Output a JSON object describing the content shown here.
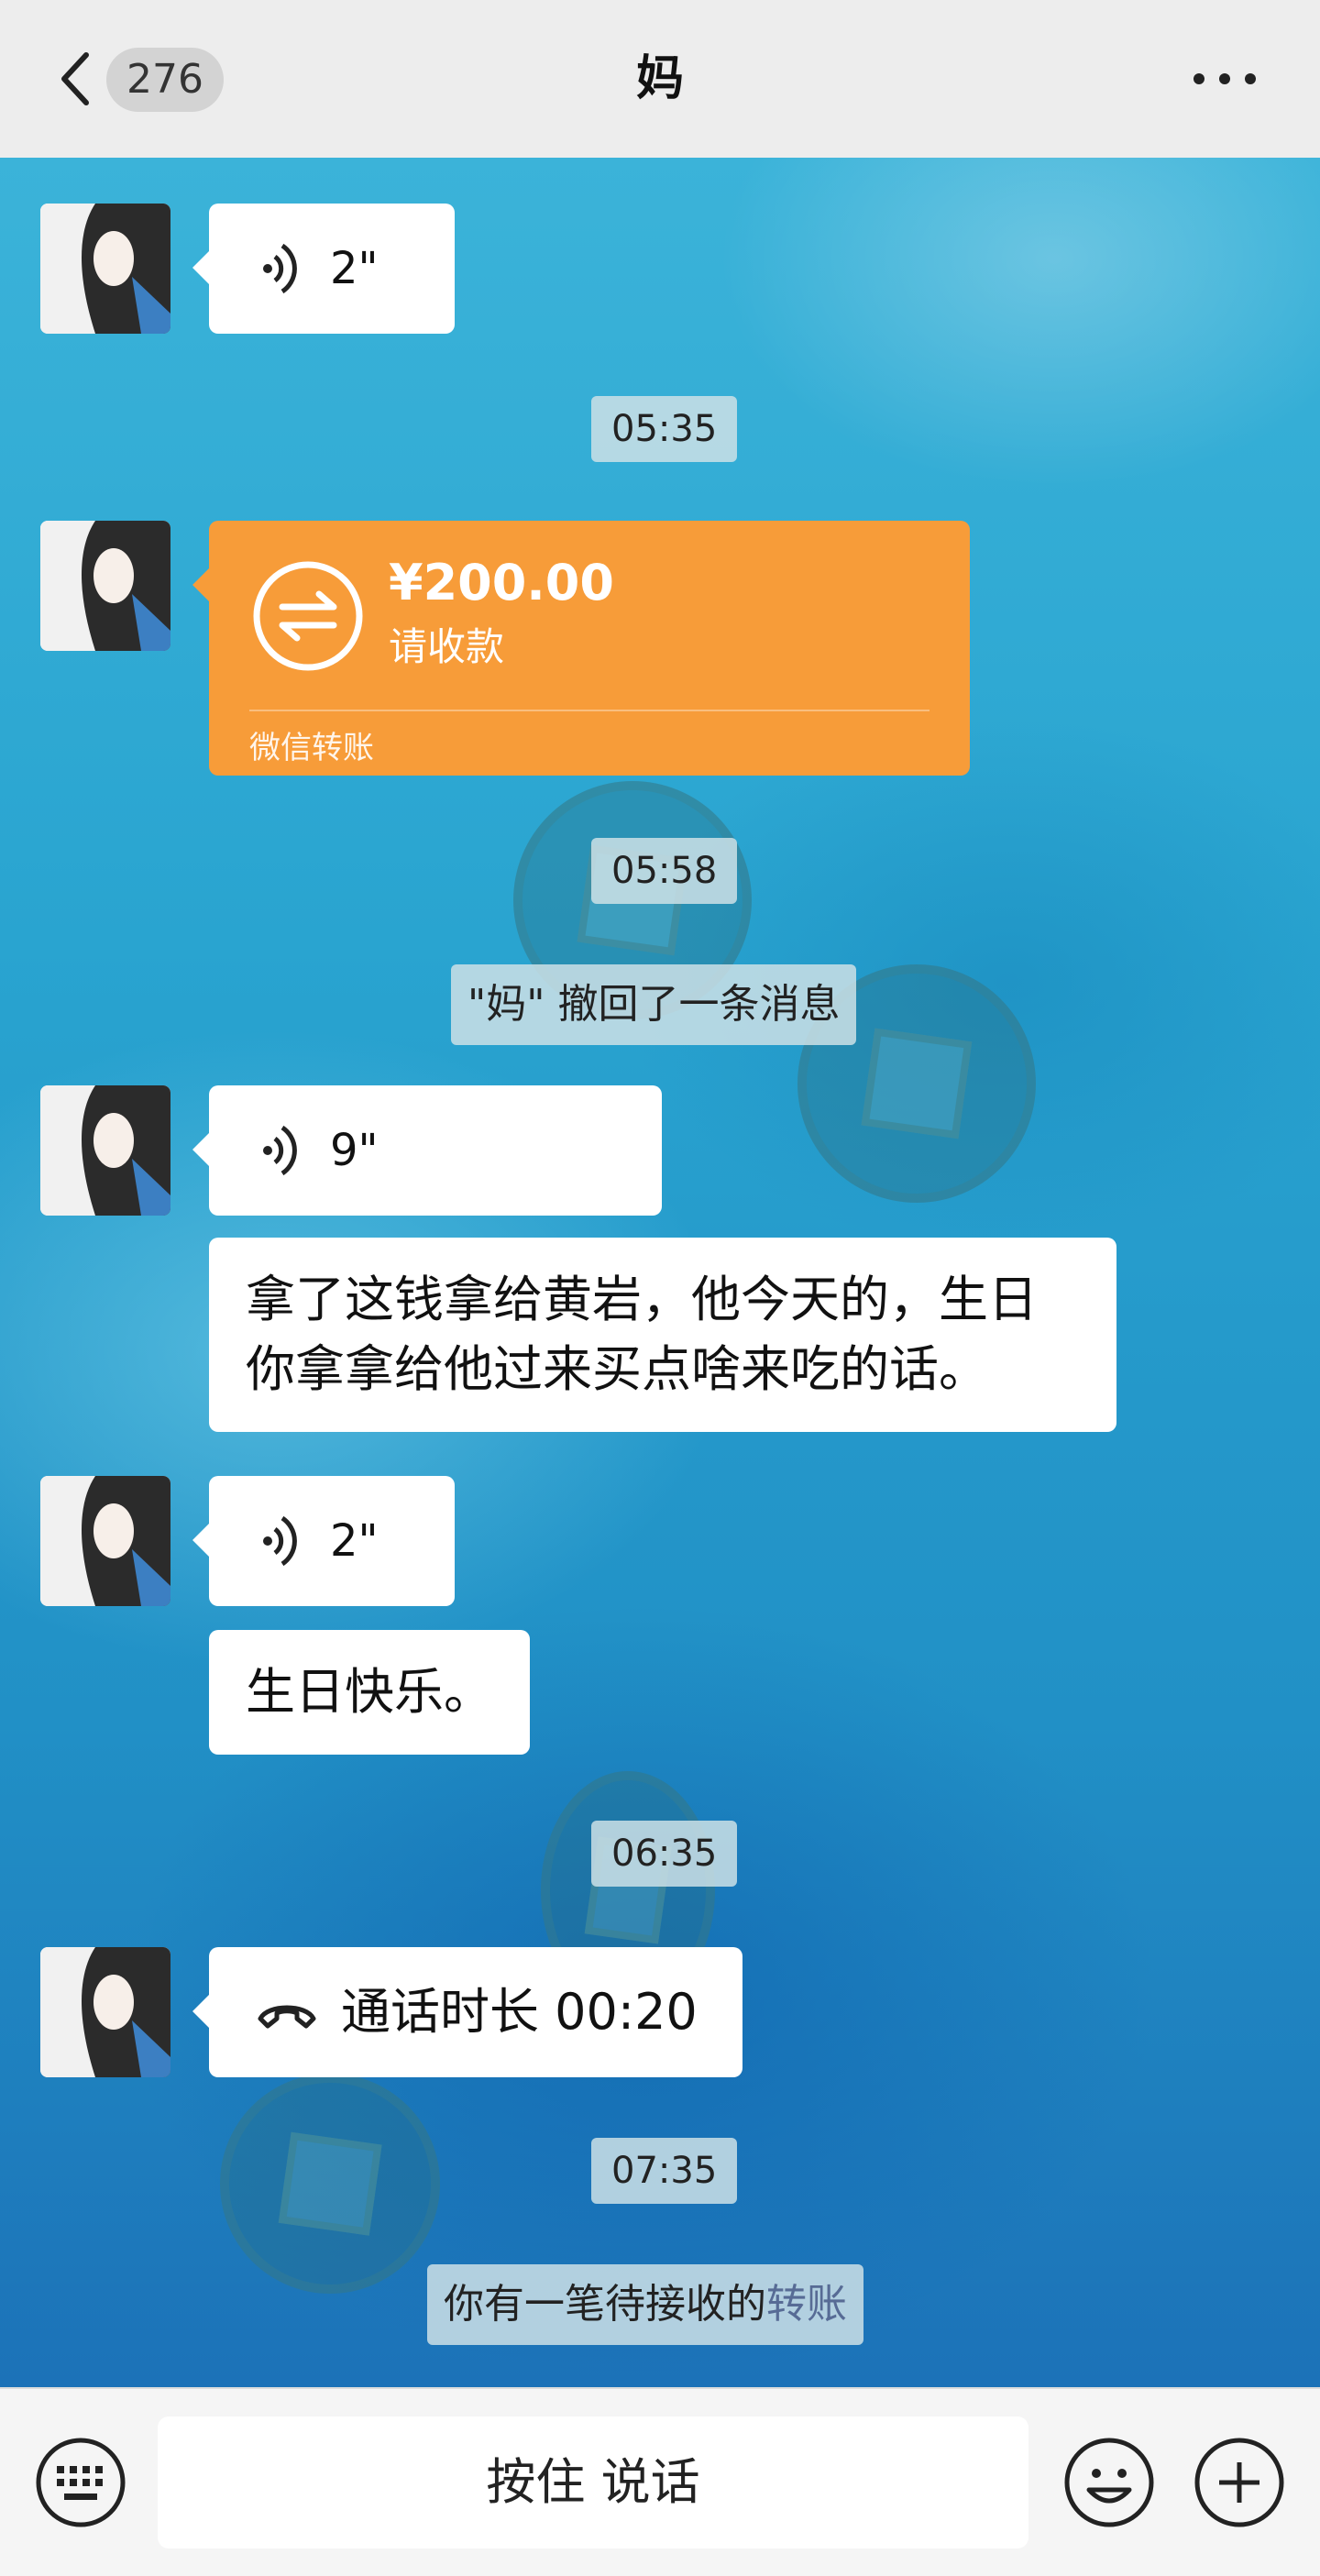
{
  "header": {
    "title": "妈",
    "unread_count": "276"
  },
  "messages": [
    {
      "type": "voice",
      "duration": "2\""
    },
    {
      "type": "time",
      "text": "05:35"
    },
    {
      "type": "transfer",
      "amount": "¥200.00",
      "status": "请收款",
      "footer": "微信转账"
    },
    {
      "type": "time",
      "text": "05:58"
    },
    {
      "type": "system",
      "text": "\"妈\" 撤回了一条消息"
    },
    {
      "type": "voice",
      "duration": "9\""
    },
    {
      "type": "text",
      "line1": "拿了这钱拿给黄岩，他今天的，生日",
      "line2": "你拿拿给他过来买点啥来吃的话。"
    },
    {
      "type": "voice",
      "duration": "2\""
    },
    {
      "type": "text",
      "line1": "生日快乐。"
    },
    {
      "type": "time",
      "text": "06:35"
    },
    {
      "type": "call",
      "text": "通话时长 00:20"
    },
    {
      "type": "time",
      "text": "07:35"
    },
    {
      "type": "system",
      "text": "你有一笔待接收的",
      "link": "转账"
    }
  ],
  "input": {
    "hold_to_talk": "按住 说话"
  },
  "colors": {
    "transfer_orange": "#f79c39",
    "link_blue": "#576b95",
    "header_bg": "#ededed"
  }
}
